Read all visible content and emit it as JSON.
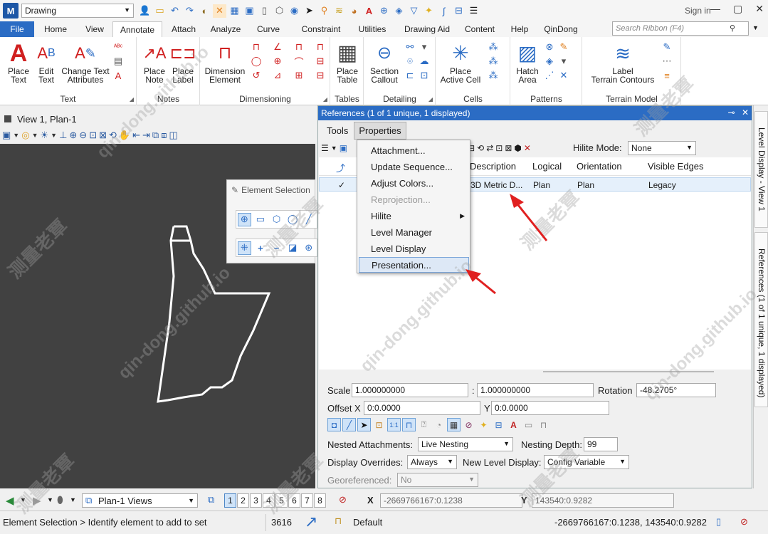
{
  "app": {
    "logo": "M",
    "workspace": "Drawing",
    "sign_in": "Sign in"
  },
  "ribbon_tabs": [
    "File",
    "Home",
    "View",
    "Annotate",
    "Attach",
    "Analyze",
    "Curve",
    "Constraint",
    "Utilities",
    "Drawing Aid",
    "Content",
    "Help",
    "QinDong"
  ],
  "search_ribbon": {
    "placeholder": "Search Ribbon (F4)"
  },
  "ribbon": {
    "text": {
      "label": "Text",
      "place_text": "Place\nText",
      "edit_text": "Edit\nText",
      "change_text": "Change Text\nAttributes"
    },
    "notes": {
      "label": "Notes",
      "place_note": "Place\nNote",
      "place_label": "Place\nLabel"
    },
    "dimensioning": {
      "label": "Dimensioning",
      "dimension_element": "Dimension\nElement"
    },
    "tables": {
      "label": "Tables",
      "place_table": "Place\nTable"
    },
    "detailing": {
      "label": "Detailing",
      "section_callout": "Section\nCallout"
    },
    "cells": {
      "label": "Cells",
      "place_active_cell": "Place\nActive Cell"
    },
    "patterns": {
      "label": "Patterns",
      "hatch_area": "Hatch\nArea"
    },
    "terrain": {
      "label": "Terrain Model",
      "label_contours": "Label\nTerrain Contours"
    }
  },
  "view": {
    "title": "View 1, Plan-1"
  },
  "element_selection": {
    "title": "Element Selection"
  },
  "references": {
    "title": "References (1 of 1 unique, 1 displayed)",
    "menu": {
      "tools": "Tools",
      "properties": "Properties"
    },
    "hilite_label": "Hilite Mode:",
    "hilite_value": "None",
    "columns": {
      "description": "Description",
      "logical": "Logical",
      "orientation": "Orientation",
      "visible_edges": "Visible Edges"
    },
    "row": {
      "check": "✓",
      "description": "3D Metric D...",
      "logical": "Plan",
      "orientation": "Plan",
      "visible_edges": "Legacy"
    },
    "scale_label": "Scale",
    "scale_a": "1.000000000",
    "scale_sep": ":",
    "scale_b": "1.000000000",
    "rotation_label": "Rotation",
    "rotation_value": "-48.2705°",
    "offset_label": "Offset X",
    "offset_x": "0:0.0000",
    "offset_y_label": "Y",
    "offset_y": "0:0.0000",
    "nested_label": "Nested Attachments:",
    "nested_value": "Live Nesting",
    "nesting_depth_label": "Nesting Depth:",
    "nesting_depth": "99",
    "overrides_label": "Display Overrides:",
    "overrides_value": "Always",
    "new_level_label": "New Level Display:",
    "new_level_value": "Config Variable",
    "georef_label": "Georeferenced:",
    "georef_value": "No"
  },
  "properties_menu": [
    "Attachment...",
    "Update Sequence...",
    "Adjust Colors...",
    "Reprojection...",
    "Hilite",
    "Level Manager",
    "Level Display",
    "Presentation..."
  ],
  "dock_tabs": {
    "level_display": "Level Display - View 1",
    "references": "References (1 of 1 unique, 1 displayed)"
  },
  "bottom": {
    "views": "Plan-1 Views",
    "view_numbers": [
      "1",
      "2",
      "3",
      "4",
      "5",
      "6",
      "7",
      "8"
    ],
    "x_label": "X",
    "x_value": "-2669766167:0.1238",
    "y_label": "Y",
    "y_value": "143540:0.9282"
  },
  "status": {
    "prompt": "Element Selection > Identify element to add to set",
    "count": "3616",
    "level": "Default",
    "coords": "-2669766167:0.1238, 143540:0.9282"
  },
  "watermarks": [
    "测量老覃",
    "qin-dong.github.io"
  ],
  "colors": {
    "accent": "#2b6cc4",
    "canvas": "#414141",
    "arrow": "#e02020"
  }
}
